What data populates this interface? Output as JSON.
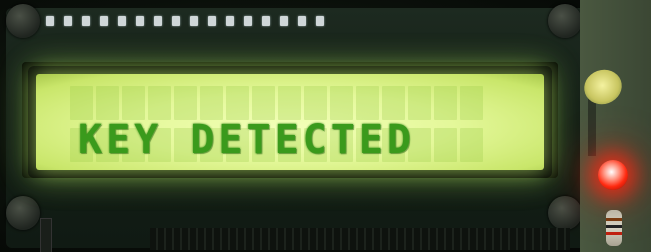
{
  "lcd": {
    "line1": "",
    "line2": "KEY DETECTED",
    "backlight_color": "#e4f89a",
    "text_color": "#3a9a1c",
    "columns": 16,
    "rows": 2
  },
  "board": {
    "pcb_color": "#152018",
    "led_color": "#ff2a10"
  }
}
